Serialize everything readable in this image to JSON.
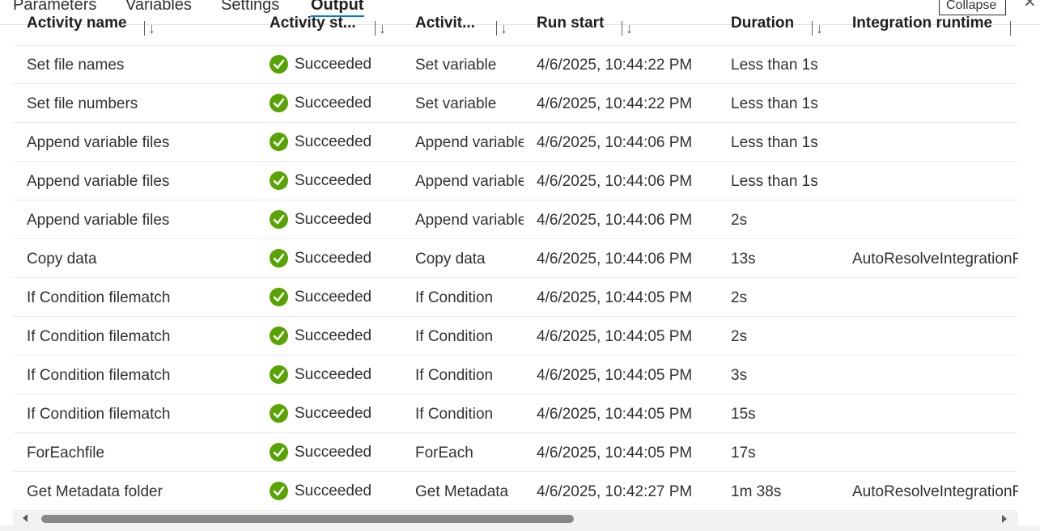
{
  "tabs": [
    {
      "label": "Parameters",
      "active": false
    },
    {
      "label": "Variables",
      "active": false
    },
    {
      "label": "Settings",
      "active": false
    },
    {
      "label": "Output",
      "active": true
    }
  ],
  "tooltip": "Collapse",
  "columns": [
    {
      "label": "Activity name"
    },
    {
      "label": "Activity st..."
    },
    {
      "label": "Activit..."
    },
    {
      "label": "Run start"
    },
    {
      "label": "Duration"
    },
    {
      "label": "Integration runtime"
    }
  ],
  "rows": [
    {
      "name": "Set file names",
      "status": "Succeeded",
      "type": "Set variable",
      "run_start": "4/6/2025, 10:44:22 PM",
      "duration": "Less than 1s",
      "runtime": ""
    },
    {
      "name": "Set file numbers",
      "status": "Succeeded",
      "type": "Set variable",
      "run_start": "4/6/2025, 10:44:22 PM",
      "duration": "Less than 1s",
      "runtime": ""
    },
    {
      "name": "Append variable files",
      "status": "Succeeded",
      "type": "Append variable",
      "run_start": "4/6/2025, 10:44:06 PM",
      "duration": "Less than 1s",
      "runtime": ""
    },
    {
      "name": "Append variable files",
      "status": "Succeeded",
      "type": "Append variable",
      "run_start": "4/6/2025, 10:44:06 PM",
      "duration": "Less than 1s",
      "runtime": ""
    },
    {
      "name": "Append variable files",
      "status": "Succeeded",
      "type": "Append variable",
      "run_start": "4/6/2025, 10:44:06 PM",
      "duration": "2s",
      "runtime": ""
    },
    {
      "name": "Copy data",
      "status": "Succeeded",
      "type": "Copy data",
      "run_start": "4/6/2025, 10:44:06 PM",
      "duration": "13s",
      "runtime": "AutoResolveIntegrationRuntime"
    },
    {
      "name": "If Condition filematch",
      "status": "Succeeded",
      "type": "If Condition",
      "run_start": "4/6/2025, 10:44:05 PM",
      "duration": "2s",
      "runtime": ""
    },
    {
      "name": "If Condition filematch",
      "status": "Succeeded",
      "type": "If Condition",
      "run_start": "4/6/2025, 10:44:05 PM",
      "duration": "2s",
      "runtime": ""
    },
    {
      "name": "If Condition filematch",
      "status": "Succeeded",
      "type": "If Condition",
      "run_start": "4/6/2025, 10:44:05 PM",
      "duration": "3s",
      "runtime": ""
    },
    {
      "name": "If Condition filematch",
      "status": "Succeeded",
      "type": "If Condition",
      "run_start": "4/6/2025, 10:44:05 PM",
      "duration": "15s",
      "runtime": ""
    },
    {
      "name": "ForEachfile",
      "status": "Succeeded",
      "type": "ForEach",
      "run_start": "4/6/2025, 10:44:05 PM",
      "duration": "17s",
      "runtime": ""
    },
    {
      "name": "Get Metadata folder",
      "status": "Succeeded",
      "type": "Get Metadata",
      "run_start": "4/6/2025, 10:42:27 PM",
      "duration": "1m 38s",
      "runtime": "AutoResolveIntegrationRuntime"
    }
  ],
  "colors": {
    "success": "#57a300",
    "accent": "#0078d4"
  },
  "icons": {
    "status": "check-circle-icon",
    "sort": "sort-icon",
    "close": "close-icon"
  },
  "scroll": {
    "horizontal_fraction": 0.53
  }
}
